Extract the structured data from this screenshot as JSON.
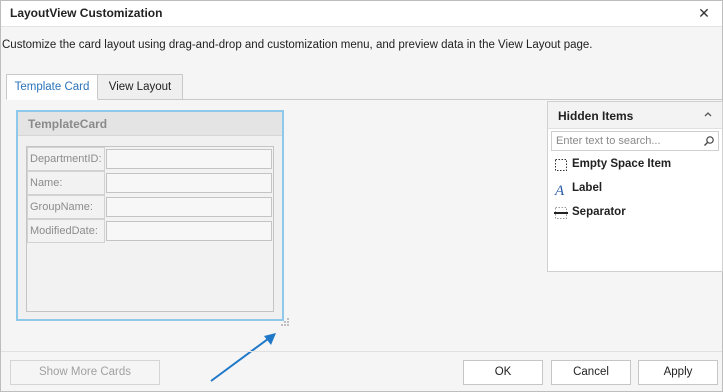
{
  "window": {
    "title": "LayoutView Customization",
    "close_glyph": "✕"
  },
  "description": "Customize the card layout using drag-and-drop and customization menu, and preview data in the View Layout page.",
  "tabs": [
    {
      "label": "Template Card",
      "active": true
    },
    {
      "label": "View Layout",
      "active": false
    }
  ],
  "template_card": {
    "title": "TemplateCard",
    "fields": [
      {
        "label": "DepartmentID:"
      },
      {
        "label": "Name:"
      },
      {
        "label": "GroupName:"
      },
      {
        "label": "ModifiedDate:"
      }
    ]
  },
  "hidden_items": {
    "title": "Hidden Items",
    "search_placeholder": "Enter text to search...",
    "items": [
      {
        "label": "Empty Space Item",
        "icon": "empty-space-icon"
      },
      {
        "label": "Label",
        "icon": "label-icon"
      },
      {
        "label": "Separator",
        "icon": "separator-icon"
      }
    ]
  },
  "buttons": {
    "show_more_cards": "Show More Cards",
    "ok": "OK",
    "cancel": "Cancel",
    "apply": "Apply"
  },
  "colors": {
    "accent": "#2b73b9",
    "card_border": "#8ec8ea",
    "arrow": "#1f78c8"
  }
}
